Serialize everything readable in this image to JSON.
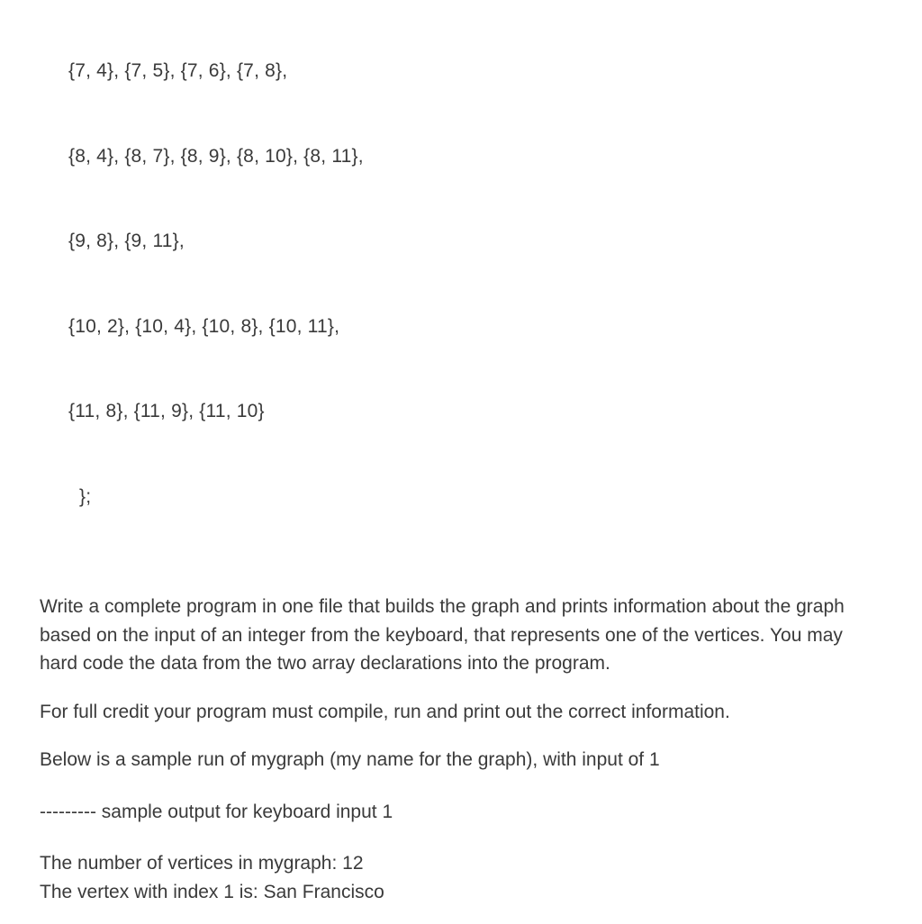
{
  "code": {
    "line1": "{7, 4}, {7, 5}, {7, 6}, {7, 8},",
    "line2": "{8, 4}, {8, 7}, {8, 9}, {8, 10}, {8, 11},",
    "line3": "{9, 8}, {9, 11},",
    "line4": "{10, 2}, {10, 4}, {10, 8}, {10, 11},",
    "line5": "{11, 8}, {11, 9}, {11, 10}",
    "close": "};"
  },
  "para1": "Write a complete program in one file that builds the graph and prints information about the graph based on the input of an integer from the keyboard, that represents one of the vertices.  You may hard code the data from the two array declarations into the program.",
  "para2": "For full credit your program must compile, run and print out the correct information.",
  "para3": "Below is a sample run of mygraph (my name for the graph), with input of 1",
  "para4": "--------- sample output for keyboard input 1",
  "out1": "The number of vertices in mygraph:  12",
  "out2": "The vertex with index 1 is:  San Francisco"
}
